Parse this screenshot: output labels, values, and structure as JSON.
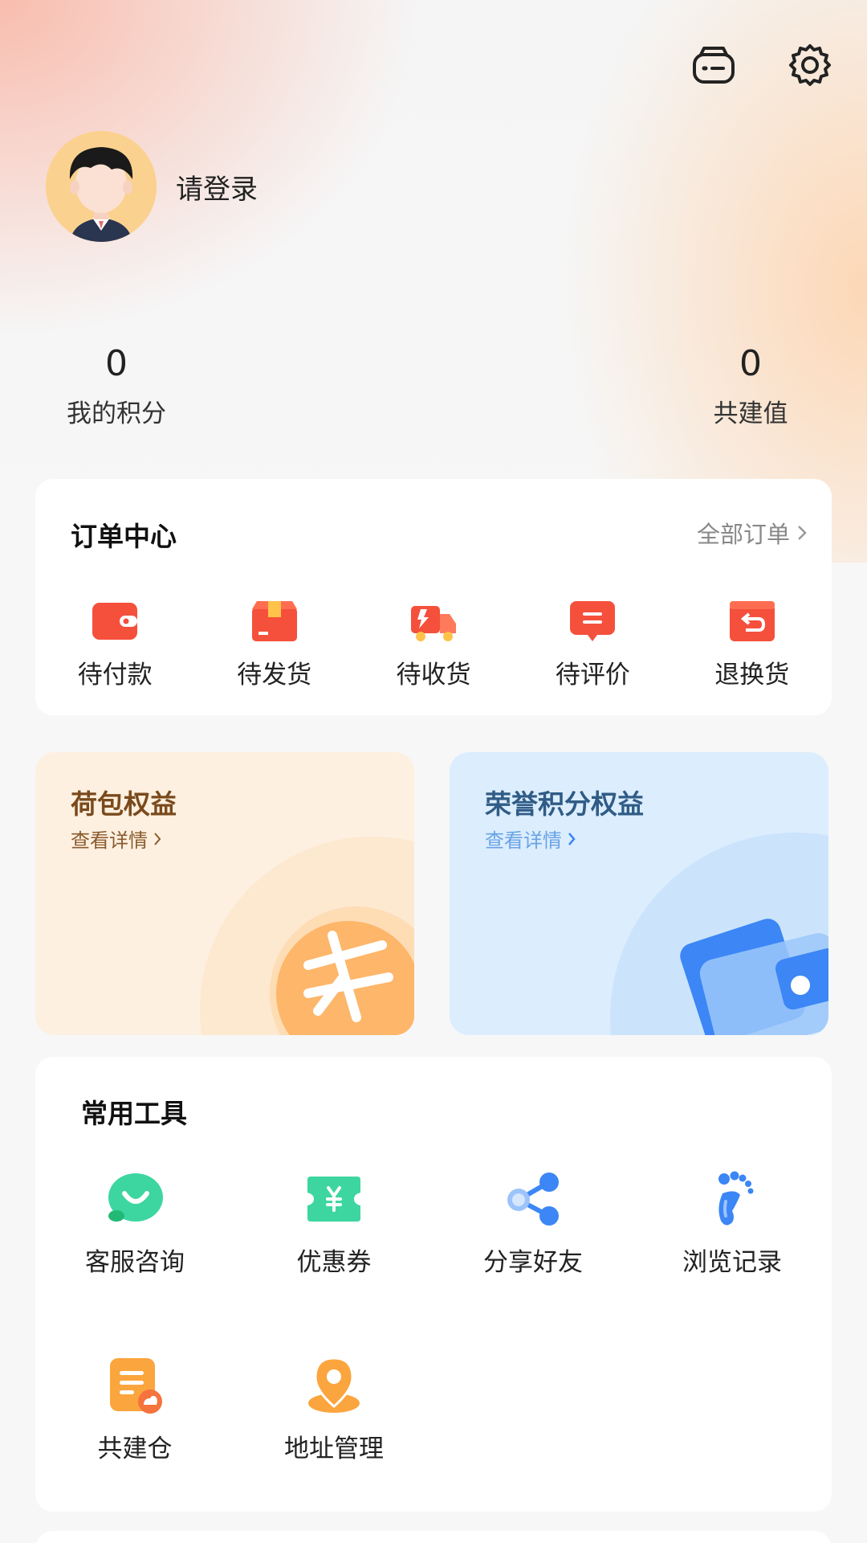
{
  "header": {
    "icons": [
      "robot-icon",
      "settings-gear-icon"
    ]
  },
  "profile": {
    "login_text": "请登录"
  },
  "stats": [
    {
      "value": "0",
      "label": "我的积分"
    },
    {
      "value": "0",
      "label": "共建值"
    }
  ],
  "orders": {
    "title": "订单中心",
    "all_link": "全部订单",
    "items": [
      {
        "label": "待付款",
        "icon": "wallet-icon"
      },
      {
        "label": "待发货",
        "icon": "package-icon"
      },
      {
        "label": "待收货",
        "icon": "delivery-truck-icon"
      },
      {
        "label": "待评价",
        "icon": "comment-icon"
      },
      {
        "label": "退换货",
        "icon": "return-icon"
      }
    ]
  },
  "benefits": [
    {
      "title": "荷包权益",
      "link": "查看详情"
    },
    {
      "title": "荣誉积分权益",
      "link": "查看详情"
    }
  ],
  "tools": {
    "title": "常用工具",
    "items": [
      {
        "label": "客服咨询",
        "icon": "customer-service-icon"
      },
      {
        "label": "优惠券",
        "icon": "coupon-icon"
      },
      {
        "label": "分享好友",
        "icon": "share-icon"
      },
      {
        "label": "浏览记录",
        "icon": "footprint-icon"
      },
      {
        "label": "共建仓",
        "icon": "warehouse-icon"
      },
      {
        "label": "地址管理",
        "icon": "location-pin-icon"
      }
    ]
  },
  "colors": {
    "order_icon_red": "#f5503c",
    "tool_green": "#3dd6a0",
    "tool_blue": "#3c86f5",
    "tool_orange": "#fba53e"
  }
}
